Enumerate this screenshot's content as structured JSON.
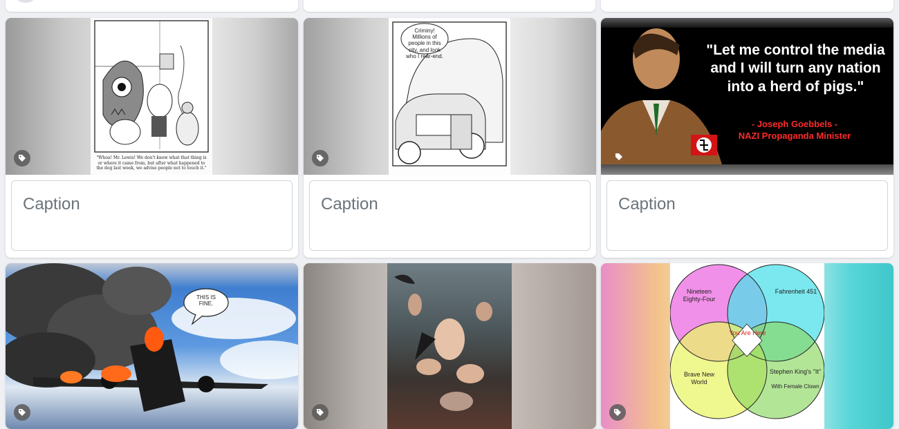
{
  "caption_placeholder": "Caption",
  "tag_icon": "tag-icon",
  "cards": [
    {
      "name": "cartoon-monster",
      "cartoon_text": "\"Whoa! Mr. Lewis! We don't know what that thing is or where it came from, but after what happened to the dog last week, we advise people not to touch it.\""
    },
    {
      "name": "cartoon-car",
      "bubble_text": "Criminy! Millions of people in this city, and look who I rear-end."
    },
    {
      "name": "goebbels-quote",
      "quote": "\"Let me control the media and I will turn any nation into a herd of pigs.\"",
      "attribution_line1": "- Joseph Goebbels -",
      "attribution_line2": "NAZI Propaganda Minister"
    },
    {
      "name": "burning-plane",
      "bubble_text": "THIS IS FINE."
    },
    {
      "name": "witches-painting"
    },
    {
      "name": "venn-diagram",
      "labels": {
        "top_left": "Nineteen Eighty-Four",
        "top_right": "Fahrenheit 451",
        "center": "You Are Here",
        "bottom_left": "Brave New World",
        "bottom_right_1": "Stephen King's \"It\"",
        "bottom_right_2": "With Female Clown"
      }
    }
  ]
}
